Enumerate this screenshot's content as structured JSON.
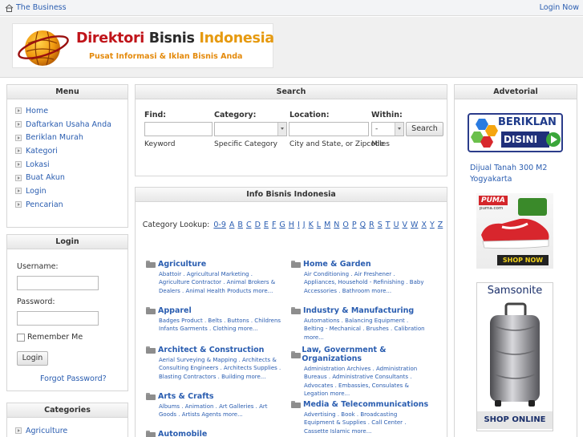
{
  "topbar": {
    "home_label": "The Business",
    "login_label": "Login Now"
  },
  "logo": {
    "title_part1": "Direktori ",
    "title_part2": "Bisnis ",
    "title_part3": "Indonesia",
    "tagline": "Pusat Informasi & Iklan Bisnis Anda"
  },
  "menu": {
    "title": "Menu",
    "items": [
      "Home",
      "Daftarkan Usaha Anda",
      "Beriklan Murah",
      "Kategori",
      "Lokasi",
      "Buat Akun",
      "Login",
      "Pencarian"
    ]
  },
  "login": {
    "title": "Login",
    "username_label": "Username:",
    "password_label": "Password:",
    "remember_label": "Remember Me",
    "button_label": "Login",
    "forgot_label": "Forgot Password?"
  },
  "categories_panel": {
    "title": "Categories",
    "items": [
      "Agriculture"
    ]
  },
  "search": {
    "title": "Search",
    "find_label": "Find:",
    "category_label": "Category:",
    "location_label": "Location:",
    "within_label": "Within:",
    "within_value": "-",
    "button_label": "Search",
    "find_hint": "Keyword",
    "category_hint": "Specific Category",
    "location_hint": "City and State, or Zipcode",
    "within_hint": "Miles"
  },
  "info": {
    "title": "Info Bisnis Indonesia",
    "lookup_label": "Category Lookup:",
    "letters": [
      "0-9",
      "A",
      "B",
      "C",
      "D",
      "E",
      "F",
      "G",
      "H",
      "I",
      "J",
      "K",
      "L",
      "M",
      "N",
      "O",
      "P",
      "Q",
      "R",
      "S",
      "T",
      "U",
      "V",
      "W",
      "X",
      "Y",
      "Z"
    ],
    "left_categories": [
      {
        "name": "Agriculture",
        "subs": "Abattoir . Agricultural Marketing . Agriculture Contractor . Animal Brokers & Dealers . Animal Health Products more..."
      },
      {
        "name": "Apparel",
        "subs": "Badges Product . Belts . Buttons . Childrens Infants Garments . Clothing more..."
      },
      {
        "name": "Architect & Construction",
        "subs": "Aerial Surveying & Mapping . Architects & Consulting Engineers . Architects Supplies . Blasting Contractors . Building more..."
      },
      {
        "name": "Arts & Crafts",
        "subs": "Albums . Animation . Art Galleries . Art Goods . Artists Agents more..."
      },
      {
        "name": "Automobile",
        "subs": ""
      }
    ],
    "right_categories": [
      {
        "name": "Home & Garden",
        "subs": "Air Conditioning . Air Freshener . Appliances, Household - Refinishing . Baby Accessories . Bathroom more..."
      },
      {
        "name": "Industry & Manufacturing",
        "subs": "Automations . Balancing Equipment . Belting - Mechanical . Brushes . Calibration more..."
      },
      {
        "name": "Law, Government & Organizations",
        "subs": "Administration Archives . Administration Bureaus . Administrative Consultants . Advocates . Embassies, Consulates & Legation more..."
      },
      {
        "name": "Media & Telecommunications",
        "subs": "Advertising . Book . Broadcasting Equipment & Supplies . Call Center . Cassette Islamic more..."
      }
    ]
  },
  "advertorial": {
    "title": "Advetorial",
    "banner_line1": "BERIKLAN",
    "banner_line2": "DISINI",
    "ad_text": "Dijual Tanah 300 M2 Yogyakarta",
    "puma_brand": "PUMA",
    "puma_site": "puma.com",
    "puma_cta": "SHOP NOW",
    "samsonite_brand": "Samsonite",
    "samsonite_cta": "SHOP ONLINE"
  },
  "colors": {
    "link": "#2a5db0",
    "logo_red": "#c0141a",
    "logo_orange": "#e48a0c",
    "puma_red": "#d4262b"
  }
}
